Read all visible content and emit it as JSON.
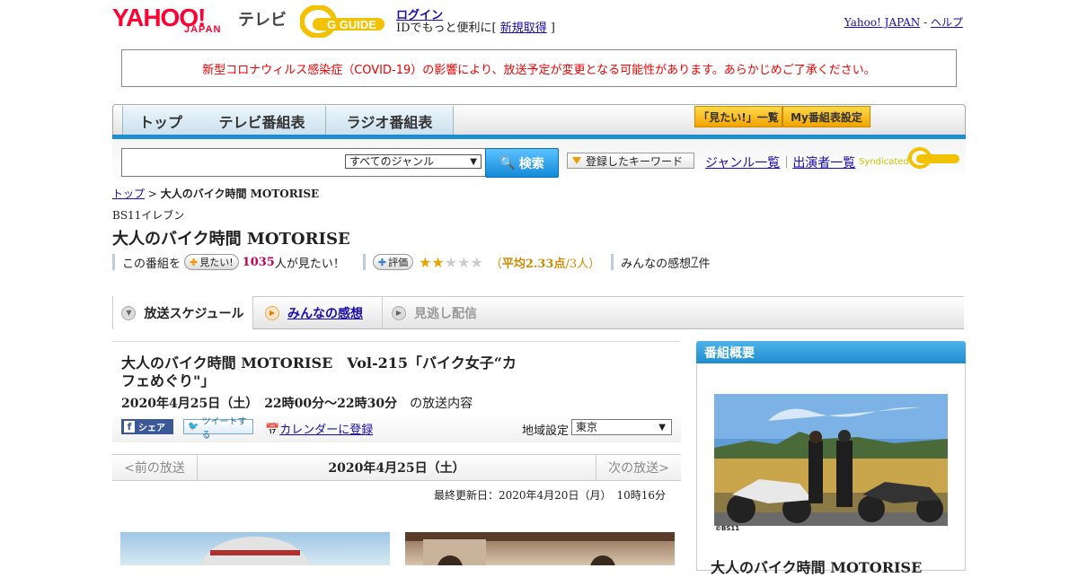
{
  "header": {
    "yahoo_logo": "YAHOO!",
    "japan": "JAPAN",
    "tv": "テレビ",
    "gguide": "G GUIDE",
    "login": "ログイン",
    "login_prefix": "IDでもっと便利に[ ",
    "register": "新規取得",
    "login_suffix": " ]",
    "yahoo_japan_link": "Yahoo! JAPAN",
    "dash": " - ",
    "help_link": "ヘルプ"
  },
  "notice": "新型コロナウィルス感染症（COVID-19）の影響により、放送予定が変更となる可能性があります。あらかじめご了承ください。",
  "nav": {
    "tabs": [
      "トップ",
      "テレビ番組表",
      "ラジオ番組表"
    ],
    "mitai_list": "「見たい!」一覧",
    "my_settings": "My番組表設定"
  },
  "search": {
    "genre_selected": "すべてのジャンル",
    "button": "検索",
    "keyword_button": "登録したキーワード",
    "genre_list": "ジャンル一覧",
    "bar": "｜",
    "performer_list": "出演者一覧",
    "syndicated": "Syndicated"
  },
  "breadcrumb": {
    "top": "トップ",
    "sep": " > ",
    "current": "大人のバイク時間 MOTORISE"
  },
  "program": {
    "channel": "BS11イレブン",
    "title": "大人のバイク時間 MOTORISE",
    "this_program": "この番組を",
    "mitai_btn": "見たい!",
    "mitai_count": "1035",
    "mitai_suffix": "人が見たい！",
    "hyouka_btn": "評価",
    "rating_stars": 2.33,
    "avg_prefix": "（",
    "avg_text": "平均2.33点",
    "avg_suffix": "/3人）",
    "impressions_prefix": "みんなの感想 ",
    "impressions_count": "7",
    "impressions_suffix": "件"
  },
  "tabs": {
    "schedule": "放送スケジュール",
    "impressions": "みんなの感想",
    "vod": "見逃し配信"
  },
  "episode": {
    "title": "大人のバイク時間 MOTORISE　Vol-215「バイク女子“カフェめぐり\"」",
    "date": "2020年4月25日（土）　22時00分～22時30分",
    "date_suffix": "の放送内容",
    "share": "シェア",
    "tweet": "ツイートする",
    "calendar": "カレンダーに登録",
    "area_label": "地域設定",
    "area_selected": "東京"
  },
  "pager": {
    "prev": "<前の放送",
    "current": "2020年4月25日（土）",
    "next": "次の放送>"
  },
  "updated": "最終更新日：2020年4月20日（月）　10時16分",
  "sidebar": {
    "heading": "番組概要",
    "credit": "©BS11",
    "title": "大人のバイク時間 MOTORISE"
  },
  "colors": {
    "brand_red": "#ff0033",
    "nav_blue": "#1d8cd0",
    "notice_red": "#ee0000",
    "mitai_pink": "#c3005a",
    "star_gold": "#e9a400"
  }
}
